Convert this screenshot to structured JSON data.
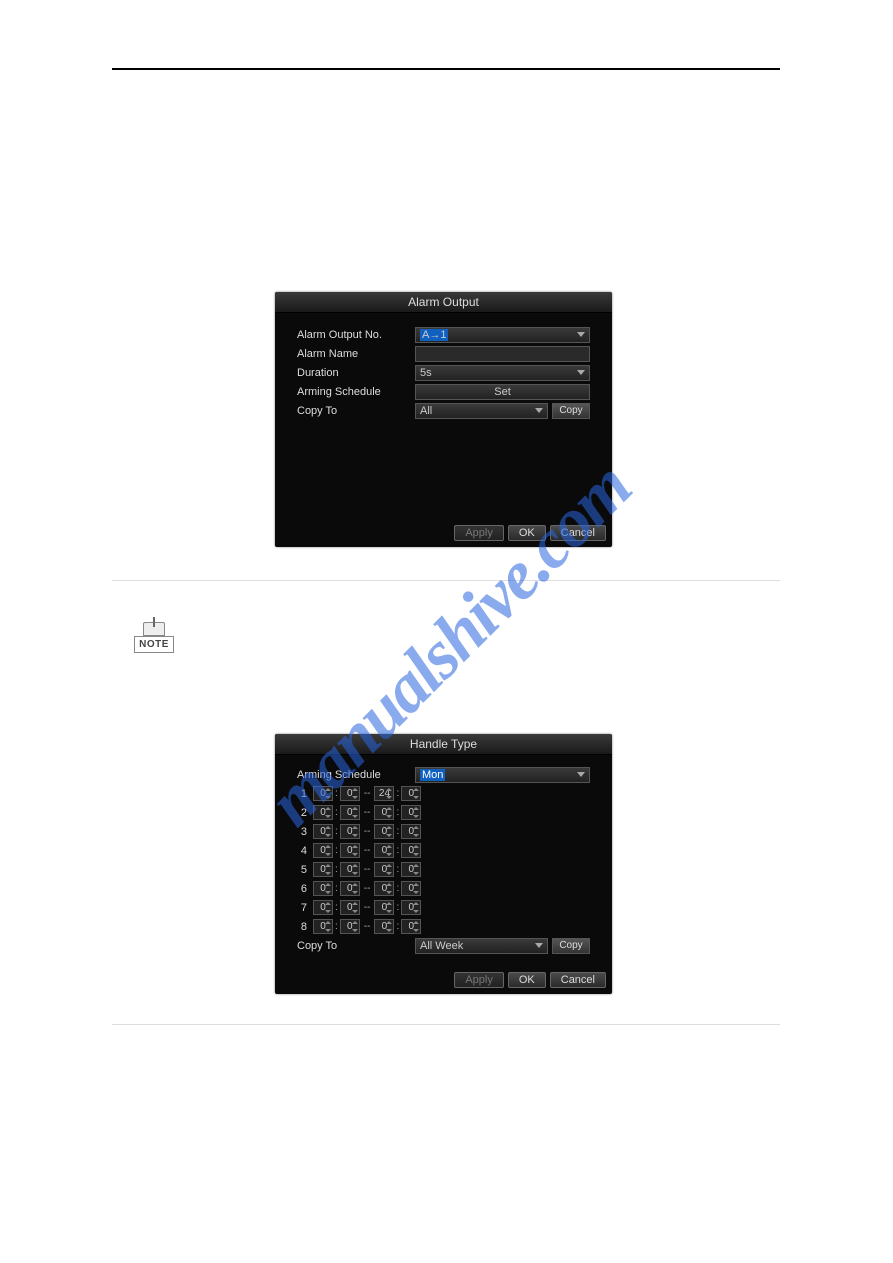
{
  "watermark": "manualshive.com",
  "note_label": "NOTE",
  "dialog1": {
    "title": "Alarm Output",
    "rows": {
      "alarm_output_no": {
        "label": "Alarm Output No.",
        "value": "A→1"
      },
      "alarm_name": {
        "label": "Alarm Name",
        "value": ""
      },
      "duration": {
        "label": "Duration",
        "value": "5s"
      },
      "arming_schedule": {
        "label": "Arming Schedule",
        "button": "Set"
      },
      "copy_to": {
        "label": "Copy To",
        "value": "All",
        "button": "Copy"
      }
    },
    "footer": {
      "apply": "Apply",
      "ok": "OK",
      "cancel": "Cancel"
    }
  },
  "dialog2": {
    "title": "Handle Type",
    "arming_label": "Arming Schedule",
    "arming_value": "Mon",
    "schedule": [
      {
        "n": "1",
        "h1": "0",
        "m1": "0",
        "h2": "24",
        "m2": "0"
      },
      {
        "n": "2",
        "h1": "0",
        "m1": "0",
        "h2": "0",
        "m2": "0"
      },
      {
        "n": "3",
        "h1": "0",
        "m1": "0",
        "h2": "0",
        "m2": "0"
      },
      {
        "n": "4",
        "h1": "0",
        "m1": "0",
        "h2": "0",
        "m2": "0"
      },
      {
        "n": "5",
        "h1": "0",
        "m1": "0",
        "h2": "0",
        "m2": "0"
      },
      {
        "n": "6",
        "h1": "0",
        "m1": "0",
        "h2": "0",
        "m2": "0"
      },
      {
        "n": "7",
        "h1": "0",
        "m1": "0",
        "h2": "0",
        "m2": "0"
      },
      {
        "n": "8",
        "h1": "0",
        "m1": "0",
        "h2": "0",
        "m2": "0"
      }
    ],
    "copy_to": {
      "label": "Copy To",
      "value": "All Week",
      "button": "Copy"
    },
    "footer": {
      "apply": "Apply",
      "ok": "OK",
      "cancel": "Cancel"
    }
  }
}
